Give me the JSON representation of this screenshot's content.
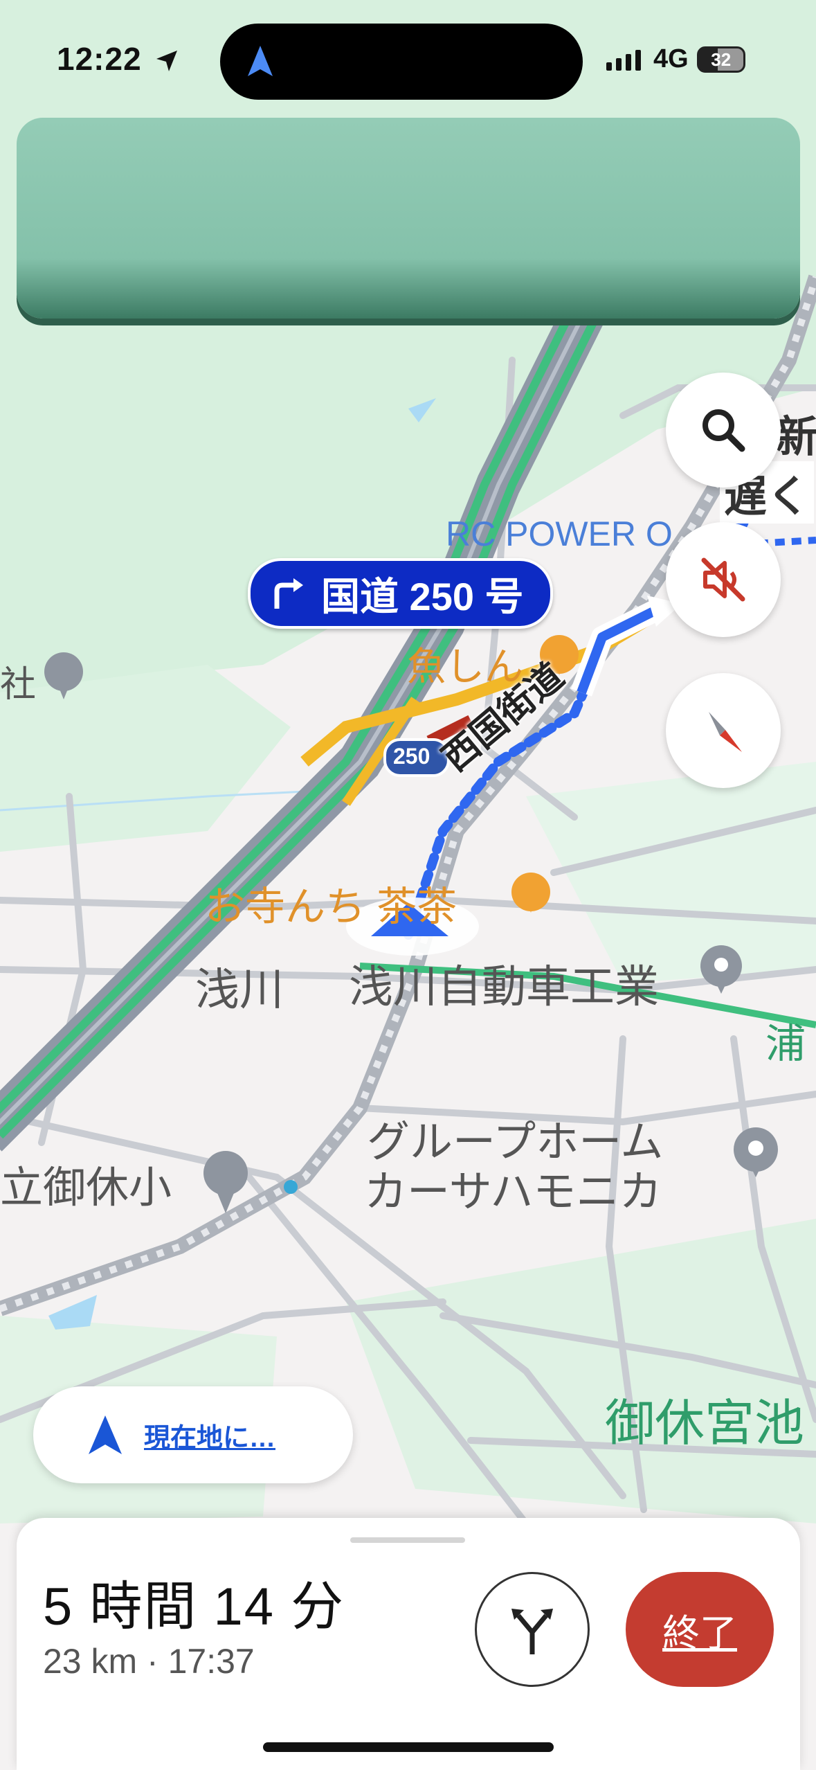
{
  "status_bar": {
    "time": "12:22",
    "network": "4G",
    "battery": "32"
  },
  "map": {
    "turn_chip": {
      "road": "国道 250 号"
    },
    "route_road_label": "西国街道",
    "route_shield": "250",
    "places": {
      "rc_power": "RC POWER O",
      "uoshin": "魚しん",
      "shrine_partial": "社",
      "otera": "お寺んち 茶茶",
      "asakawa": "浅川",
      "asakawa_motors": "浅川自動車工業",
      "ura_partial": "浦",
      "group_home_line1": "グループホーム",
      "group_home_line2": "カーサハモニカ",
      "school": "立御休小",
      "lake": "御休宮池",
      "edge_top": "新",
      "edge_bottom": "遅く"
    }
  },
  "controls": {
    "recenter_label": "現在地に…"
  },
  "bottom_sheet": {
    "eta_duration": "5 時間 14 分",
    "eta_details": "23 km · 17:37",
    "end_label": "終了"
  },
  "colors": {
    "route_blue": "#1a56d6",
    "turn_chip": "#0d2bc4",
    "end_button": "#c43c30",
    "highway_green": "#3fbf7f"
  }
}
